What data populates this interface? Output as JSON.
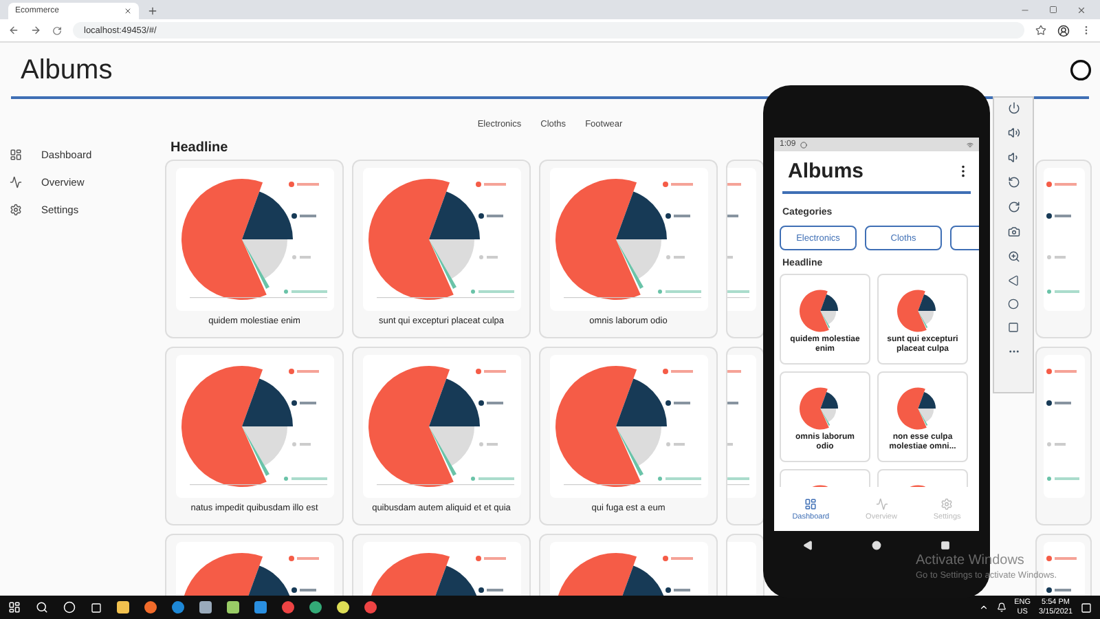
{
  "browser": {
    "tab_title": "Ecommerce",
    "url": "localhost:49453/#/"
  },
  "page": {
    "title": "Albums",
    "categories": [
      "Electronics",
      "Cloths",
      "Footwear"
    ],
    "sidebar": [
      {
        "label": "Dashboard",
        "kind": "dashboard"
      },
      {
        "label": "Overview",
        "kind": "overview"
      },
      {
        "label": "Settings",
        "kind": "settings"
      }
    ],
    "headline": "Headline",
    "cards": [
      {
        "kind": "full",
        "title": "quidem molestiae enim"
      },
      {
        "kind": "full",
        "title": "sunt qui excepturi placeat culpa"
      },
      {
        "kind": "full",
        "title": "omnis laborum odio"
      },
      {
        "kind": "left_edge"
      },
      {
        "kind": "right_part"
      },
      {
        "kind": "full",
        "title": "natus impedit quibusdam illo est"
      },
      {
        "kind": "full",
        "title": "quibusdam autem aliquid et et quia"
      },
      {
        "kind": "full",
        "title": "qui fuga est a eum"
      },
      {
        "kind": "left_edge"
      },
      {
        "kind": "right_part"
      },
      {
        "kind": "full"
      },
      {
        "kind": "full"
      },
      {
        "kind": "full"
      },
      {
        "kind": "left_edge_cut"
      },
      {
        "kind": "right_part"
      }
    ]
  },
  "phone": {
    "status_time": "1:09",
    "title": "Albums",
    "categories_label": "Categories",
    "chips": [
      "Electronics",
      "Cloths"
    ],
    "headline": "Headline",
    "cards": [
      {
        "kind": "titled",
        "title": "quidem molestiae enim"
      },
      {
        "kind": "titled",
        "title": "sunt qui excepturi placeat culpa"
      },
      {
        "kind": "titled",
        "title": "omnis laborum odio"
      },
      {
        "kind": "titled",
        "title": "non esse culpa molestiae omni..."
      },
      {
        "kind": "cut"
      },
      {
        "kind": "cut"
      }
    ],
    "nav": [
      {
        "label": "Dashboard",
        "kind": "dashboard",
        "selected": true
      },
      {
        "label": "Overview",
        "kind": "overview",
        "selected": false
      },
      {
        "label": "Settings",
        "kind": "settings",
        "selected": false
      }
    ]
  },
  "activation": {
    "title": "Activate Windows",
    "subtitle": "Go to Settings to activate Windows."
  },
  "taskbar": {
    "language": "ENG",
    "region": "US",
    "time": "5:54 PM",
    "date": "3/15/2021"
  }
}
